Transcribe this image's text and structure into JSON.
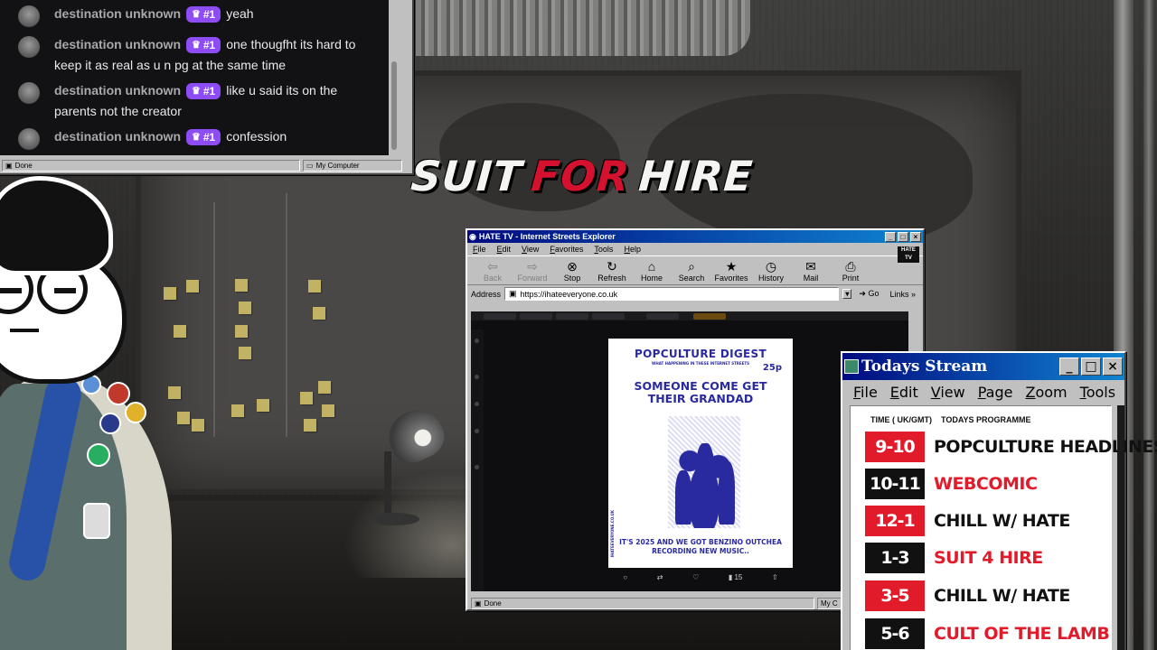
{
  "chat": {
    "messages": [
      {
        "user": "destination unknown",
        "badge": "#1",
        "text": "yeah"
      },
      {
        "user": "destination unknown",
        "badge": "#1",
        "text": "one thougfht its hard to keep it as real as u n pg at the same time"
      },
      {
        "user": "destination unknown",
        "badge": "#1",
        "text": "like u said its on the parents not the creator"
      },
      {
        "user": "destination unknown",
        "badge": "#1",
        "text": "confession"
      }
    ],
    "status_left": "Done",
    "status_right": "My Computer"
  },
  "logo": {
    "part1": "SUIT",
    "part2": "FOR",
    "part3": "HIRE"
  },
  "ie": {
    "title": "HATE TV - Internet Streets Explorer",
    "menu": [
      "File",
      "Edit",
      "View",
      "Favorites",
      "Tools",
      "Help"
    ],
    "toolbar": [
      "Back",
      "Forward",
      "Stop",
      "Refresh",
      "Home",
      "Search",
      "Favorites",
      "History",
      "Mail",
      "Print"
    ],
    "address_label": "Address",
    "url": "https://ihateeveryone.co.uk",
    "go": "Go",
    "links": "Links",
    "status_left": "Done",
    "status_right": "My C",
    "logo_text": "HATE TV"
  },
  "poster": {
    "title": "POPCULTURE DIGEST",
    "subtitle": "WHAT HAPPENING IN THESE INTERNET STREETS",
    "price": "25p",
    "headline": "SOMEONE COME GET THEIR GRANDAD",
    "caption": "IT'S 2025 AND WE GOT BENZINO OUTCHEA RECORDING NEW MUSIC..",
    "side": "IHATEEVERYONE.CO.UK",
    "post_count": "15"
  },
  "stream": {
    "title": "Todays Stream",
    "menu": [
      "File",
      "Edit",
      "View",
      "Page",
      "Zoom",
      "Tools"
    ],
    "head_time": "TIME ( UK/GMT)",
    "head_prog": "TODAYS PROGRAMME",
    "rows": [
      {
        "time": "9-10",
        "programme": "POPCULTURE HEADLINES",
        "time_color": "#e21b2b",
        "prog_color": "#111111"
      },
      {
        "time": "10-11",
        "programme": "WEBCOMIC",
        "time_color": "#111111",
        "prog_color": "#e21b2b"
      },
      {
        "time": "12-1",
        "programme": "CHILL W/ HATE",
        "time_color": "#e21b2b",
        "prog_color": "#111111"
      },
      {
        "time": "1-3",
        "programme": "SUIT 4 HIRE",
        "time_color": "#111111",
        "prog_color": "#e21b2b"
      },
      {
        "time": "3-5",
        "programme": "CHILL W/ HATE",
        "time_color": "#e21b2b",
        "prog_color": "#111111"
      },
      {
        "time": "5-6",
        "programme": "CULT OF THE LAMB",
        "time_color": "#111111",
        "prog_color": "#e21b2b"
      }
    ]
  },
  "colors": {
    "accent_red": "#d4122f",
    "badge_purple": "#8d4cf5",
    "win_title": "#000a80"
  }
}
